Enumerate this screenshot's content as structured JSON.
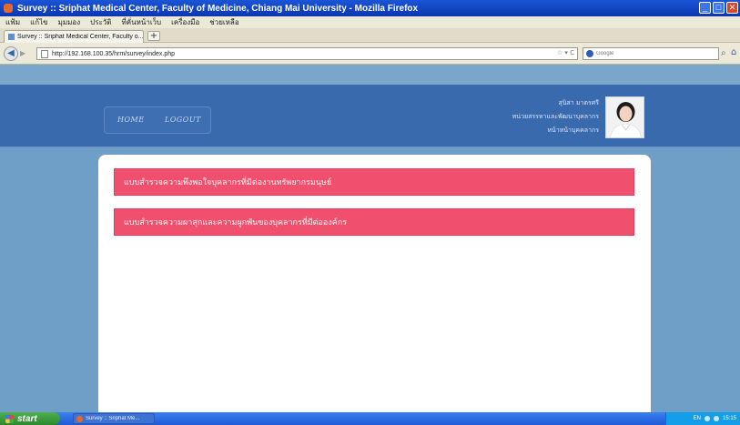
{
  "window": {
    "title": "Survey :: Sriphat Medical Center, Faculty of Medicine, Chiang Mai University - Mozilla Firefox",
    "minimize": "_",
    "maximize": "□",
    "close": "✕"
  },
  "menu": {
    "items": [
      "แฟ้ม",
      "แก้ไข",
      "มุมมอง",
      "ประวัติ",
      "ที่คั่นหน้าเว็บ",
      "เครื่องมือ",
      "ช่วยเหลือ"
    ]
  },
  "tabs": {
    "active_label": "Survey :: Sriphat Medical Center, Faculty o...",
    "new_tab": "+"
  },
  "navbar": {
    "url": "http://192.168.100.35/hrm/survey/index.php",
    "url_controls": "☆ ▾ C",
    "search_placeholder": "Google"
  },
  "header": {
    "nav": {
      "home": "HOME",
      "logout": "LOGOUT"
    },
    "user": {
      "name": "สุนิสา มาตรศรี",
      "unit": "หน่วยสรรหาและพัฒนาบุคลากร",
      "position": "หน้าหน้าบุคคลากร"
    }
  },
  "surveys": [
    {
      "label": "แบบสำรวจความพึงพอใจบุคลากรที่มีต่องานทรัพยากรมนุษย์"
    },
    {
      "label": "แบบสำรวจความผาสุกและความผูกพันของบุคลากรที่มีต่อองค์กร"
    }
  ],
  "taskbar": {
    "start": "start",
    "task_label": "Survey :: Sriphat Me...",
    "tray_lang": "EN",
    "clock": "15:15"
  },
  "colors": {
    "header_blue": "#3a6aae",
    "page_blue": "#6f9fc7",
    "survey_pink": "#f0506e"
  }
}
